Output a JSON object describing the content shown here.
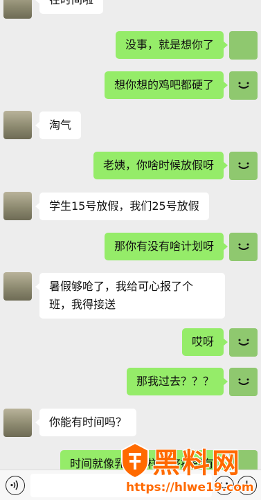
{
  "messages": [
    {
      "side": "peer",
      "text": "在时间啦"
    },
    {
      "side": "me",
      "text": "没事，就是想你了"
    },
    {
      "side": "me",
      "text": "想你想的鸡吧都硬了"
    },
    {
      "side": "peer",
      "text": "淘气"
    },
    {
      "side": "me",
      "text": "老姨，你啥时候放假呀"
    },
    {
      "side": "peer",
      "text": "学生15号放假，我们25号放假"
    },
    {
      "side": "me",
      "text": "那你有没有啥计划呀"
    },
    {
      "side": "peer",
      "text_line1": "暑假够呛了，我给可心报了个",
      "text_line2": "班，我得接送"
    },
    {
      "side": "me",
      "text": "哎呀"
    },
    {
      "side": "me",
      "text": "那我过去？？？"
    },
    {
      "side": "peer",
      "text": "你能有时间吗？"
    },
    {
      "side": "me",
      "text": "时间就像乳沟一样，挤挤就有"
    }
  ],
  "toolbar": {
    "voice_icon": "voice-icon",
    "emoji_icon": "emoji-icon",
    "plus_icon": "plus-icon"
  },
  "watermark": {
    "brand": "黑料网",
    "url": "https://hlwe19.com"
  },
  "colors": {
    "me_bubble": "#95ec69",
    "peer_bubble": "#ffffff",
    "background": "#ededed",
    "watermark": "#ff6a00"
  }
}
